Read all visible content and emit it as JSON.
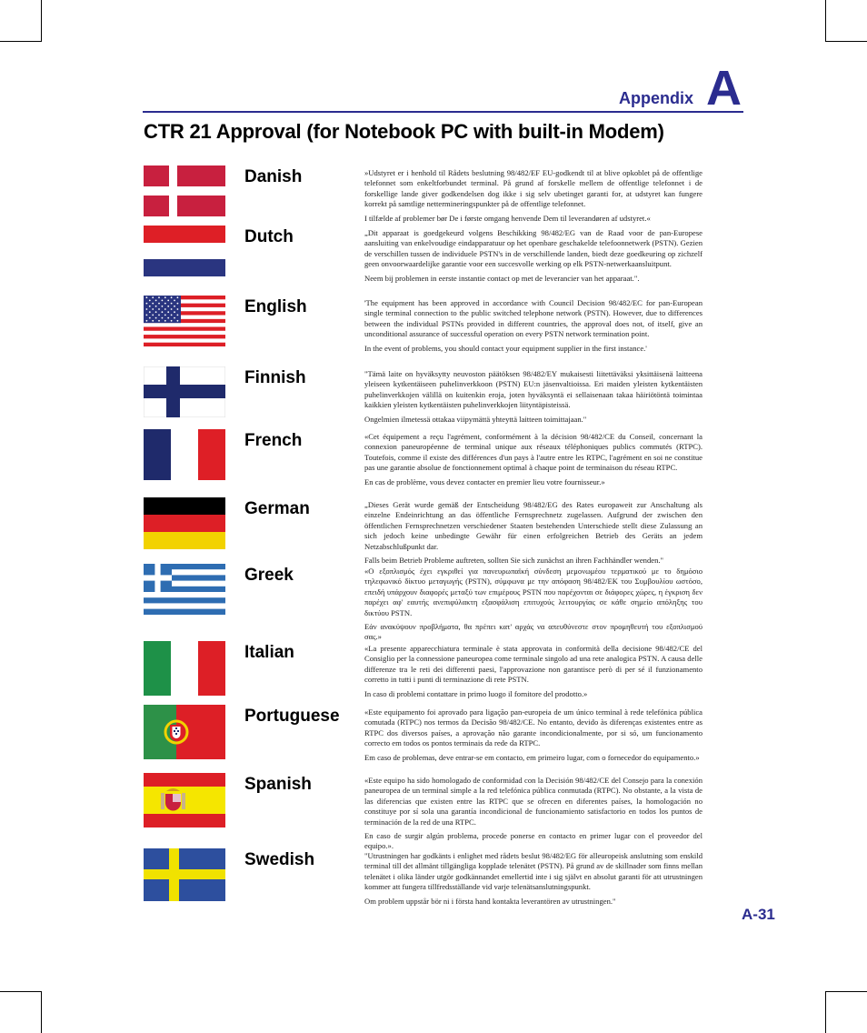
{
  "header": {
    "section_label": "Appendix",
    "section_letter": "A"
  },
  "title": "CTR 21 Approval (for Notebook PC with built-in Modem)",
  "colors": {
    "accent": "#2b2c8f"
  },
  "entries": [
    {
      "language": "Danish",
      "flag_icon": "denmark-flag-icon",
      "paragraphs": [
        "»Udstyret er i henhold til Rådets beslutning 98/482/EF EU-godkendt til at blive opkoblet på de offentlige telefonnet som enkeltforbundet terminal. På grund af forskelle mellem de offentlige telefonnet i de forskellige lande giver godkendelsen dog ikke i sig selv ubetinget garanti for, at udstyret kan fungere korrekt på samtlige nettermineringspunkter på de offentlige telefonnet.",
        "I tilfælde af problemer bør De i første omgang henvende Dem til leverandøren af udstyret.«"
      ]
    },
    {
      "language": "Dutch",
      "flag_icon": "netherlands-flag-icon",
      "paragraphs": [
        "„Dit apparaat is goedgekeurd volgens Beschikking 98/482/EG van de Raad voor de pan-Europese aansluiting van enkelvoudige eindapparatuur op het openbare geschakelde telefoonnetwerk (PSTN). Gezien de verschillen tussen de individuele PSTN's in de verschillende landen, biedt deze goedkeuring op zichzelf geen onvoorwaardelijke garantie voor een succesvolle werking op elk PSTN-netwerkaansluitpunt.",
        "Neem bij problemen in eerste instantie contact op met de leverancier van het apparaat.\"."
      ]
    },
    {
      "language": "English",
      "flag_icon": "usa-flag-icon",
      "paragraphs": [
        "'The equipment has been approved in accordance with Council Decision 98/482/EC for pan-European single terminal connection to the public switched telephone network (PSTN). However, due to differences between the individual PSTNs provided in different countries, the approval does not, of itself, give an unconditional assurance of successful operation on every PSTN network termination point.",
        "In the event of problems, you should contact your equipment supplier in the first instance.'"
      ]
    },
    {
      "language": "Finnish",
      "flag_icon": "finland-flag-icon",
      "paragraphs": [
        "\"Tämä laite on hyväksytty neuvoston päätöksen 98/482/EY mukaisesti liitettäväksi yksittäisenä laitteena yleiseen kytkentäiseen puhelinverkkoon (PSTN) EU:n jäsenvaltioissa. Eri maiden yleisten kytkentäisten puhelinverkkojen välillä on kuitenkin eroja, joten hyväksyntä ei sellaisenaan takaa häiriötöntä toimintaa kaikkien yleisten kytkentäisten puhelinverkkojen liityntäpisteissä.",
        "Ongelmien ilmetessä ottakaa viipymättä yhteyttä laitteen toimittajaan.\""
      ]
    },
    {
      "language": "French",
      "flag_icon": "france-flag-icon",
      "paragraphs": [
        "«Cet équipement a reçu l'agrément, conformément à la décision 98/482/CE du Conseil, concernant la connexion paneuropéenne de terminal unique aux réseaux téléphoniques publics commutés (RTPC). Toutefois, comme il existe des différences d'un pays à l'autre entre les RTPC, l'agrément en soi ne constitue pas une garantie absolue de fonctionnement optimal à chaque point de terminaison du réseau RTPC.",
        "En cas de problème, vous devez contacter en premier lieu votre fournisseur.»"
      ]
    },
    {
      "language": "German",
      "flag_icon": "germany-flag-icon",
      "paragraphs": [
        "„Dieses Gerät wurde gemäß der Entscheidung 98/482/EG des Rates europaweit zur Anschaltung als einzelne Endeinrichtung an das öffentliche Fernsprechnetz zugelassen. Aufgrund der zwischen den öffentlichen Fernsprechnetzen verschiedener Staaten bestehenden Unterschiede stellt diese Zulassung an sich jedoch keine unbedingte Gewähr für einen erfolgreichen Betrieb des Geräts an jedem Netzabschlußpunkt dar.",
        "Falls beim Betrieb Probleme auftreten, sollten Sie sich zunächst an ihren Fachhändler wenden.\""
      ]
    },
    {
      "language": "Greek",
      "flag_icon": "greece-flag-icon",
      "paragraphs": [
        "«Ο εξοπλισμός έχει εγκριθεί για πανευρωπαϊκή σύνδεση μεμονωμέου τερματικού με το δημόσιο τηλεφωνικό δίκτυο μεταγωγής (PSTN), σύμφωνα με την απόφαση 98/482/ΕΚ του Συμβουλίου ωστόσο, επειδή υπάρχουν διαφορές μεταξύ των επιμέρους PSTN που παρέχονται σε διάφορες χώρες, η έγκριση δεν παρέχει αφ' εαυτής ανεπιφύλακτη εξασφάλιση επιτυχούς λειτουργίας σε κάθε σημείο απόληξης του δικτύου PSTN.",
        "Εάν ανακύψουν προβλήματα, θα πρέπει κατ' αρχάς να απευθύνεστε στον προμηθευτή του εξοπλισμού σας.»"
      ]
    },
    {
      "language": "Italian",
      "flag_icon": "italy-flag-icon",
      "paragraphs": [
        "«La presente apparecchiatura terminale è stata approvata in conformità della decisione 98/482/CE del Consiglio per la connessione paneuropea come terminale singolo ad una rete analogica PSTN. A causa delle differenze tra le reti dei differenti paesi, l'approvazione non garantisce però di per sé il funzionamento corretto in tutti i punti di terminazione di rete PSTN.",
        "In caso di problemi contattare in primo luogo il fornitore del prodotto.»"
      ]
    },
    {
      "language": "Portuguese",
      "flag_icon": "portugal-flag-icon",
      "paragraphs": [
        "«Este equipamento foi aprovado para ligação pan-europeia de um único terminal à rede telefónica pública comutada (RTPC) nos termos da Decisão 98/482/CE. No entanto, devido às diferenças existentes entre as RTPC dos diversos países, a aprovação não garante incondicionalmente, por si só, um funcionamento correcto em todos os pontos terminais da rede da RTPC.",
        "Em caso de problemas, deve entrar-se em contacto, em primeiro lugar, com o fornecedor do equipamento.»"
      ]
    },
    {
      "language": "Spanish",
      "flag_icon": "spain-flag-icon",
      "paragraphs": [
        "«Este equipo ha sido homologado de conformidad con la Decisión 98/482/CE del Consejo para la conexión paneuropea de un terminal simple a la red telefónica pública conmutada (RTPC). No obstante, a la vista de las diferencias que existen entre las RTPC que se ofrecen en diferentes países, la homologación no constituye por sí sola una garantía incondicional de funcionamiento satisfactorio en todos los puntos de terminación de la red de una RTPC.",
        "En caso de surgir algún problema, procede ponerse en contacto en primer lugar con el proveedor del equipo.»."
      ]
    },
    {
      "language": "Swedish",
      "flag_icon": "sweden-flag-icon",
      "paragraphs": [
        "\"Utrustningen har godkänts i enlighet med rådets beslut 98/482/EG för alleuropeisk anslutning som enskild terminal till det allmänt tillgängliga kopplade telenätet (PSTN). På grund av de skillnader som finns mellan telenätet i olika länder utgör godkännandet emellertid inte i sig självt en absolut garanti för att utrustningen kommer att fungera tillfredsställande vid varje telenätsanslutningspunkt.",
        "Om problem uppstår bör ni i första hand kontakta leverantören av utrustningen.\""
      ]
    }
  ],
  "footer": {
    "page_number": "A-31"
  }
}
